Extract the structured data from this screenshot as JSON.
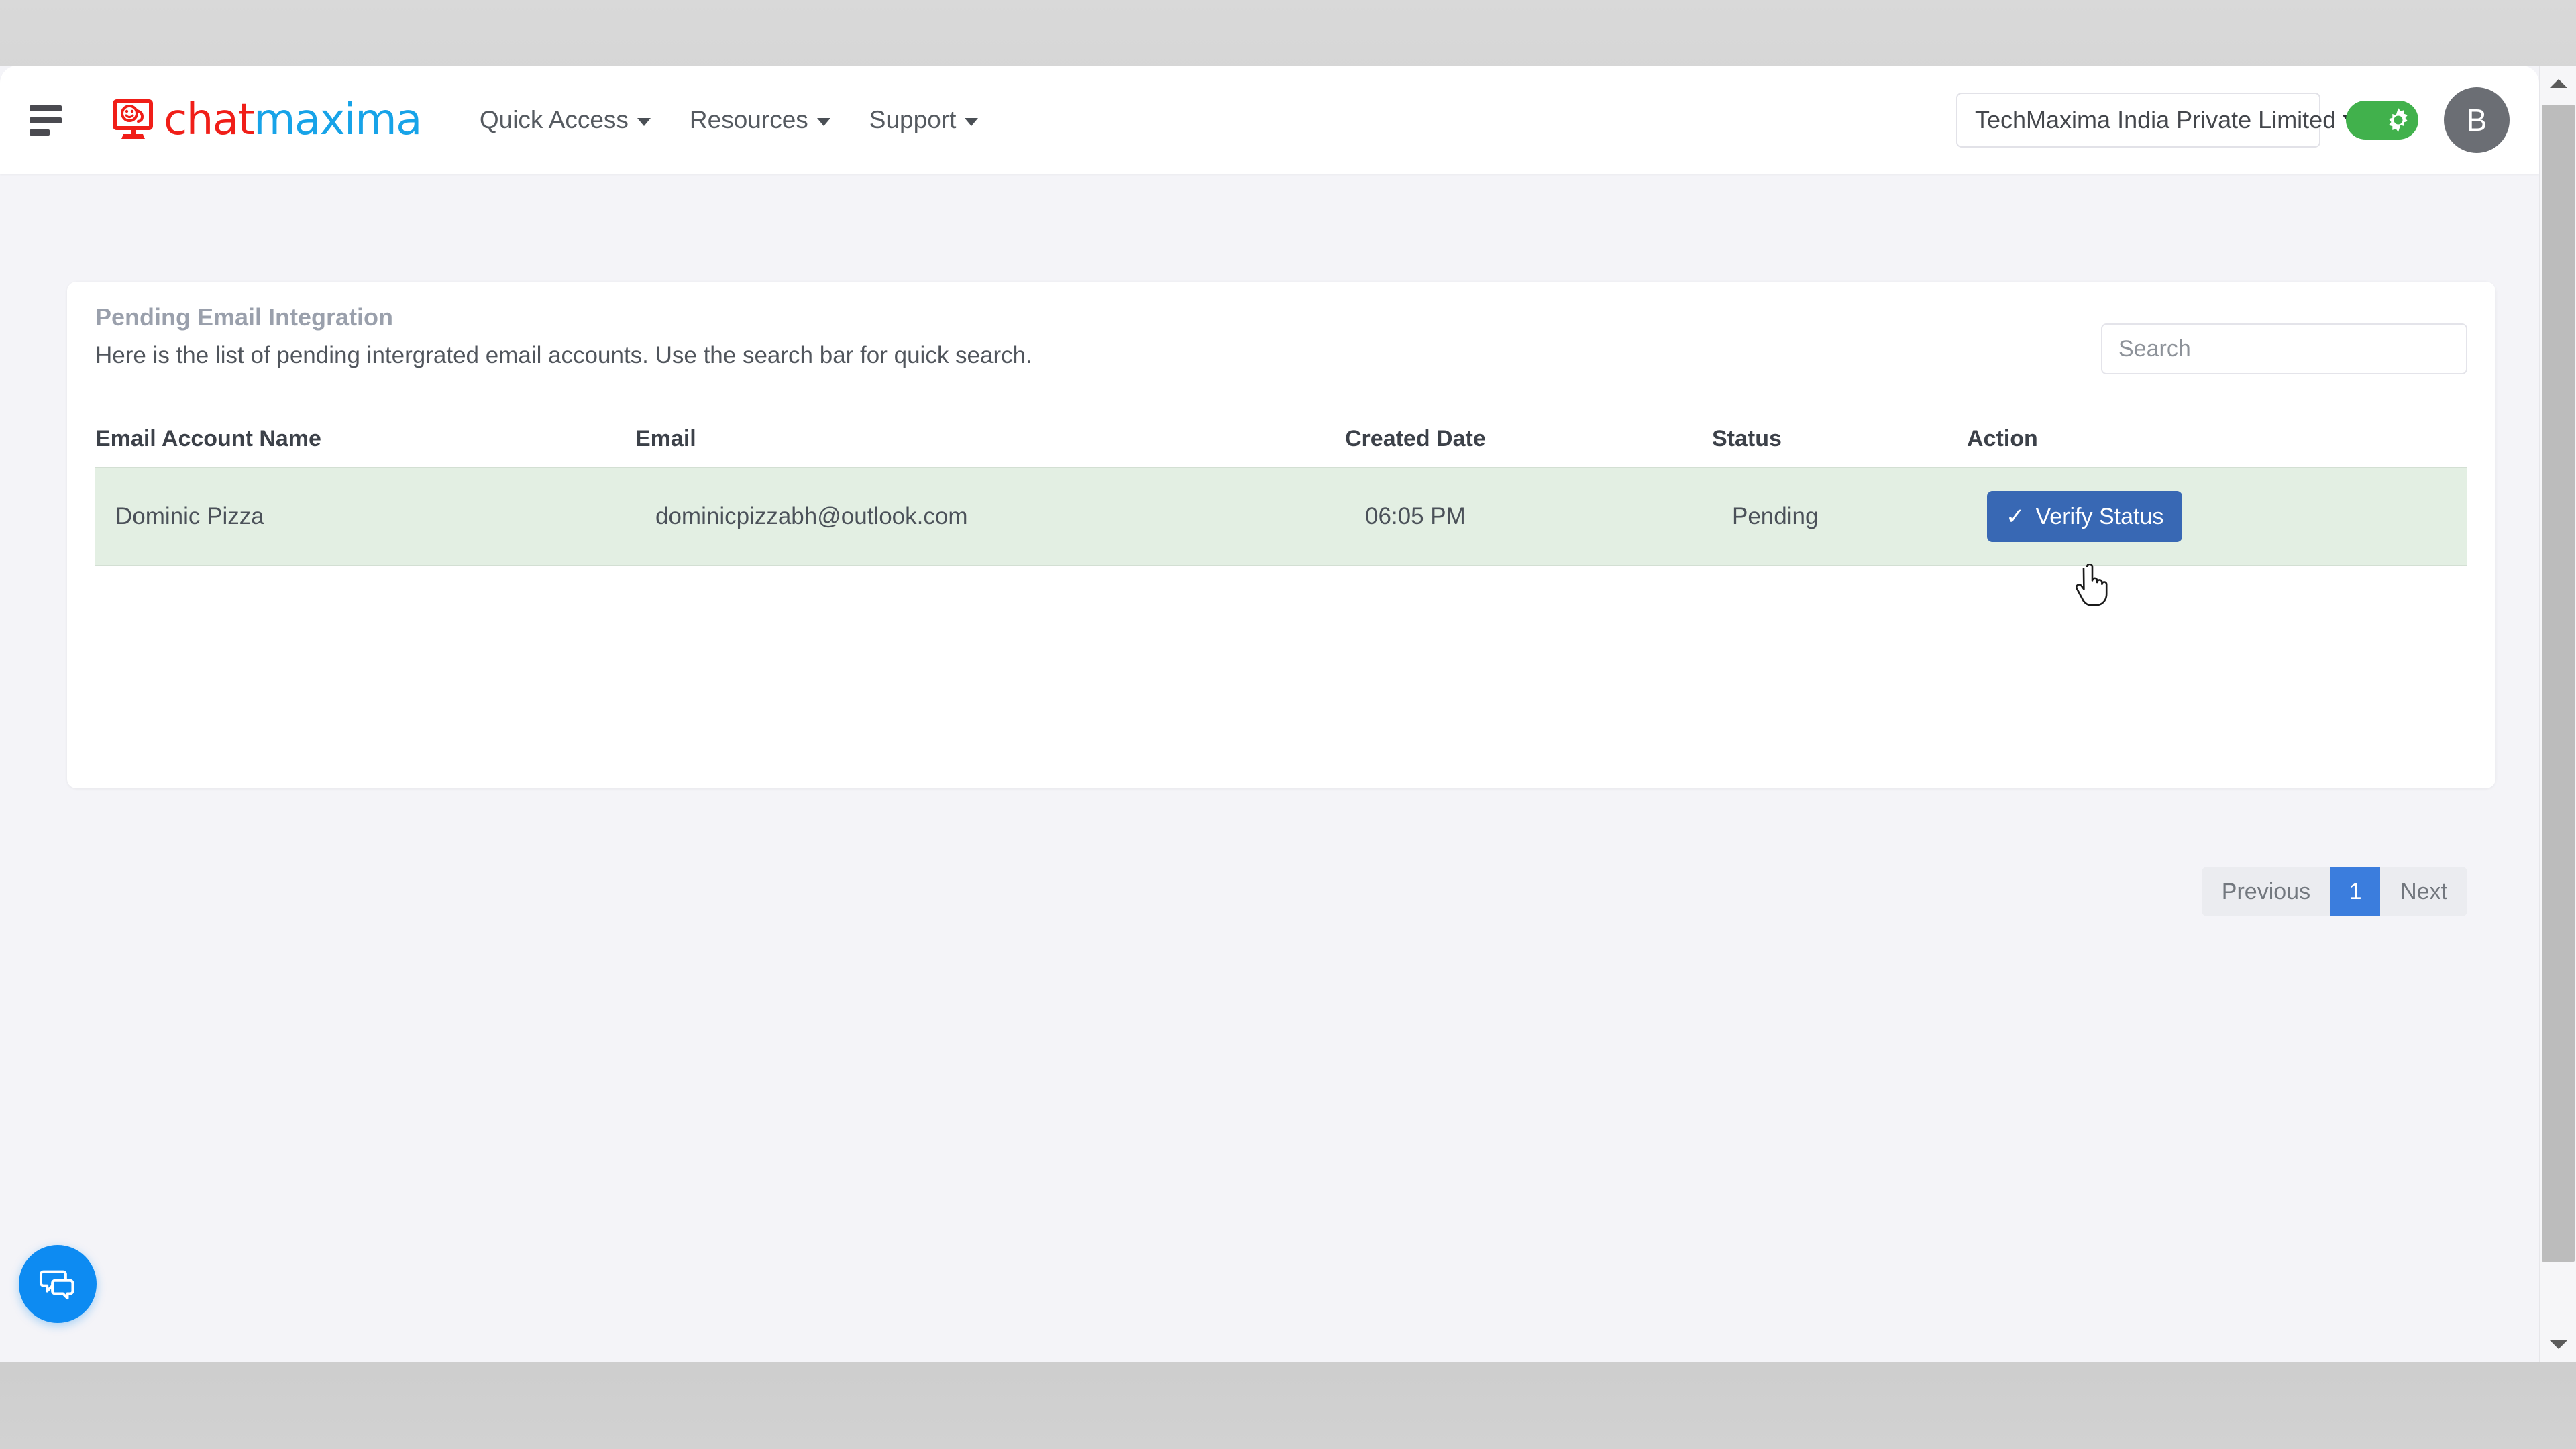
{
  "header": {
    "menu_icon": "hamburger-icon",
    "logo": {
      "text_red": "chat",
      "text_blue": "maxima",
      "mark": "monitor-smiley-icon"
    },
    "nav": [
      {
        "label": "Quick Access",
        "icon": "chevron-down-icon"
      },
      {
        "label": "Resources",
        "icon": "chevron-down-icon"
      },
      {
        "label": "Support",
        "icon": "chevron-down-icon"
      }
    ],
    "org_selector": {
      "value": "TechMaxima India Private Limited",
      "icon": "chevron-down-icon"
    },
    "theme_toggle": {
      "state": "on",
      "icon": "sun-gear-icon",
      "color": "#41b14c"
    },
    "avatar": {
      "initial": "B",
      "color": "#6b6e74"
    }
  },
  "card": {
    "title": "Pending Email Integration",
    "subtitle": "Here is the list of pending intergrated email accounts. Use the search bar for quick search.",
    "search": {
      "value": "",
      "placeholder": "Search",
      "icon": "search-input"
    }
  },
  "table": {
    "columns": [
      "Email Account Name",
      "Email",
      "Created Date",
      "Status",
      "Action"
    ],
    "rows": [
      {
        "email_account_name": "Dominic Pizza",
        "email": "dominicpizzabh@outlook.com",
        "created_date": "06:05 PM",
        "status": "Pending",
        "action_label": "Verify Status",
        "action_icon": "check-icon",
        "row_color": "#e3efe3"
      }
    ]
  },
  "pagination": {
    "previous_label": "Previous",
    "next_label": "Next",
    "pages": [
      "1"
    ],
    "current_page": "1",
    "active_color": "#3b7ddd"
  },
  "chat_launcher": {
    "icon": "chat-bubbles-icon",
    "color": "#0d8bf2"
  },
  "colors": {
    "primary_button": "#3868b4",
    "page_background": "#f4f4f8",
    "card_background": "#ffffff",
    "logo_red": "#f01e18",
    "logo_blue": "#17a3e8"
  }
}
